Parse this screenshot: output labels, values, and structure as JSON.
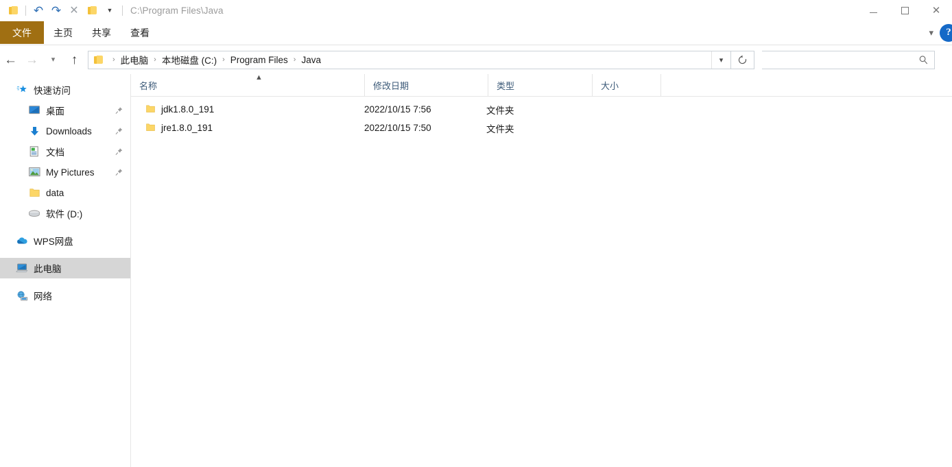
{
  "window": {
    "title": "C:\\Program Files\\Java",
    "quick_access_toolbar": [
      {
        "name": "folder-icon",
        "label": "属性"
      },
      {
        "name": "undo-icon",
        "label": "撤消"
      },
      {
        "name": "redo-icon",
        "label": "恢复"
      },
      {
        "name": "delete-icon",
        "label": "删除"
      },
      {
        "name": "new-folder-icon",
        "label": "新建文件夹"
      },
      {
        "name": "customize-dropdown-icon",
        "label": "自定义快速访问工具栏"
      }
    ],
    "controls": {
      "minimize": "最小化",
      "maximize": "最大化",
      "close": "关闭"
    }
  },
  "ribbon": {
    "tabs": [
      {
        "label": "文件",
        "active": true
      },
      {
        "label": "主页",
        "active": false
      },
      {
        "label": "共享",
        "active": false
      },
      {
        "label": "查看",
        "active": false
      }
    ],
    "expand_label": "展开功能区",
    "help_label": "?"
  },
  "navbar": {
    "back_label": "后退",
    "forward_label": "前进",
    "recent_label": "最近浏览的位置",
    "up_label": "上移一级",
    "breadcrumb": [
      "此电脑",
      "本地磁盘 (C:)",
      "Program Files",
      "Java"
    ],
    "breadcrumb_separator": "›",
    "address_dropdown_label": "以前的位置",
    "refresh_label": "刷新",
    "search": {
      "value": "",
      "placeholder": ""
    }
  },
  "sidebar": {
    "groups": [
      {
        "name": "快速访问",
        "icon": "star-icon",
        "items": [
          {
            "label": "桌面",
            "icon": "desktop-icon",
            "pinned": true
          },
          {
            "label": "Downloads",
            "icon": "download-icon",
            "pinned": true
          },
          {
            "label": "文档",
            "icon": "document-icon",
            "pinned": true
          },
          {
            "label": "My Pictures",
            "icon": "pictures-icon",
            "pinned": true
          },
          {
            "label": "data",
            "icon": "folder-icon",
            "pinned": false
          },
          {
            "label": "软件 (D:)",
            "icon": "drive-icon",
            "pinned": false
          }
        ]
      },
      {
        "name": "WPS网盘",
        "icon": "cloud-icon",
        "items": []
      },
      {
        "name": "此电脑",
        "icon": "computer-icon",
        "items": [],
        "selected": true
      },
      {
        "name": "网络",
        "icon": "network-icon",
        "items": []
      }
    ]
  },
  "filelist": {
    "columns": [
      {
        "label": "名称",
        "sort": "asc"
      },
      {
        "label": "修改日期",
        "sort": null
      },
      {
        "label": "类型",
        "sort": null
      },
      {
        "label": "大小",
        "sort": null
      }
    ],
    "rows": [
      {
        "name": "jdk1.8.0_191",
        "date": "2022/10/15 7:56",
        "type": "文件夹",
        "size": ""
      },
      {
        "name": "jre1.8.0_191",
        "date": "2022/10/15 7:50",
        "type": "文件夹",
        "size": ""
      }
    ]
  },
  "colors": {
    "file_tab": "#a06f12",
    "folder_icon": "#fcd667",
    "selection": "#d6d6d6",
    "column_header_text": "#3c5a78",
    "accent_blue": "#1569c7"
  }
}
